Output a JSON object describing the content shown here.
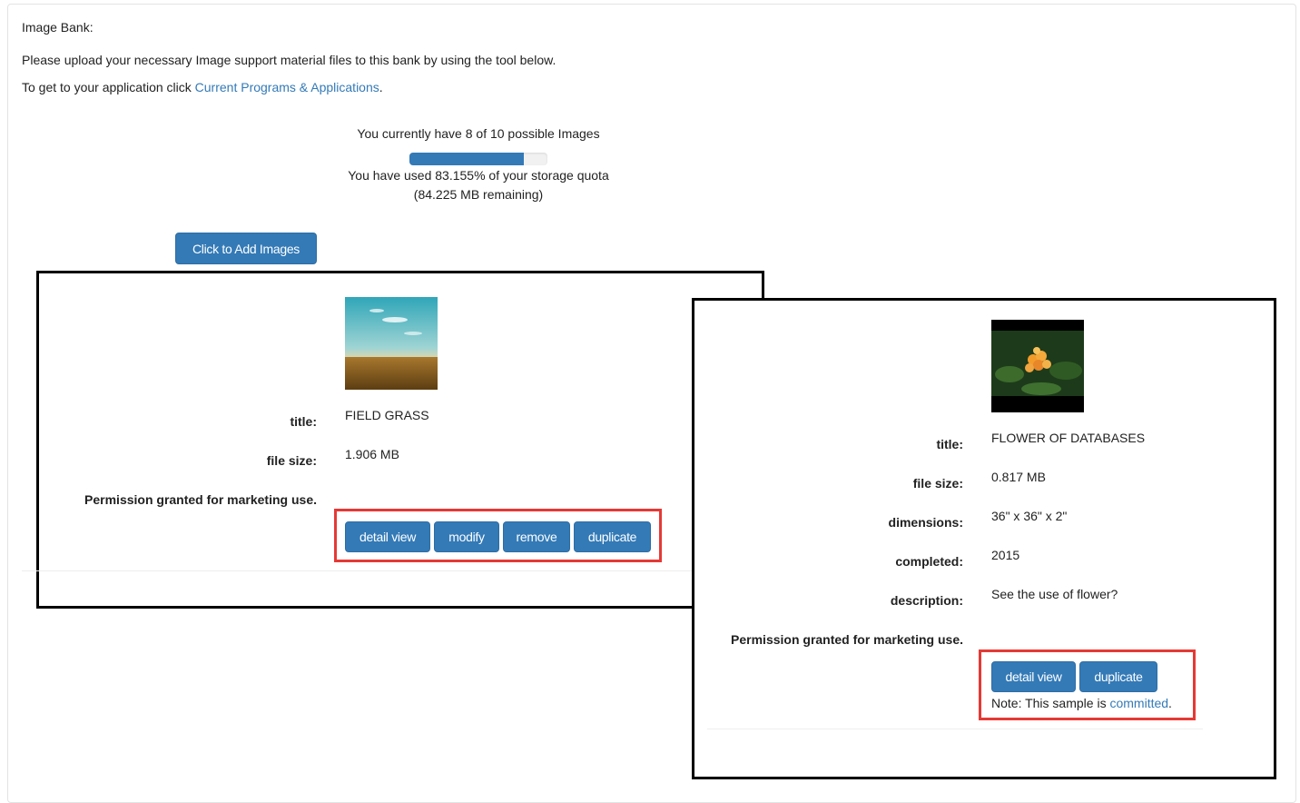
{
  "header": {
    "title": "Image Bank:",
    "instructions": "Please upload your necessary Image support material files to this bank by using the tool below.",
    "app_prefix": "To get to your application click ",
    "app_link": "Current Programs & Applications",
    "app_suffix": "."
  },
  "quota": {
    "images_text": "You currently have 8 of 10 possible Images",
    "used_text": "You have used 83.155% of your storage quota",
    "remaining_text": "(84.225 MB remaining)",
    "used_percent": 83.155
  },
  "add_button": "Click to Add Images",
  "card1": {
    "labels": {
      "title": "title:",
      "file_size": "file size:",
      "permission": "Permission granted for marketing use."
    },
    "values": {
      "title": "FIELD GRASS",
      "file_size": "1.906 MB"
    },
    "buttons": {
      "detail": "detail view",
      "modify": "modify",
      "remove": "remove",
      "duplicate": "duplicate"
    }
  },
  "card2": {
    "labels": {
      "title": "title:",
      "file_size": "file size:",
      "dimensions": "dimensions:",
      "completed": "completed:",
      "description": "description:",
      "permission": "Permission granted for marketing use."
    },
    "values": {
      "title": "FLOWER OF DATABASES",
      "file_size": "0.817 MB",
      "dimensions": "36\" x 36\" x 2\"",
      "completed": "2015",
      "description": "See the use of flower?"
    },
    "buttons": {
      "detail": "detail view",
      "duplicate": "duplicate"
    },
    "note_prefix": "Note: This sample is ",
    "note_link": "committed",
    "note_suffix": "."
  },
  "colors": {
    "primary": "#337ab7",
    "highlight": "#e53935",
    "frame": "#000000"
  }
}
